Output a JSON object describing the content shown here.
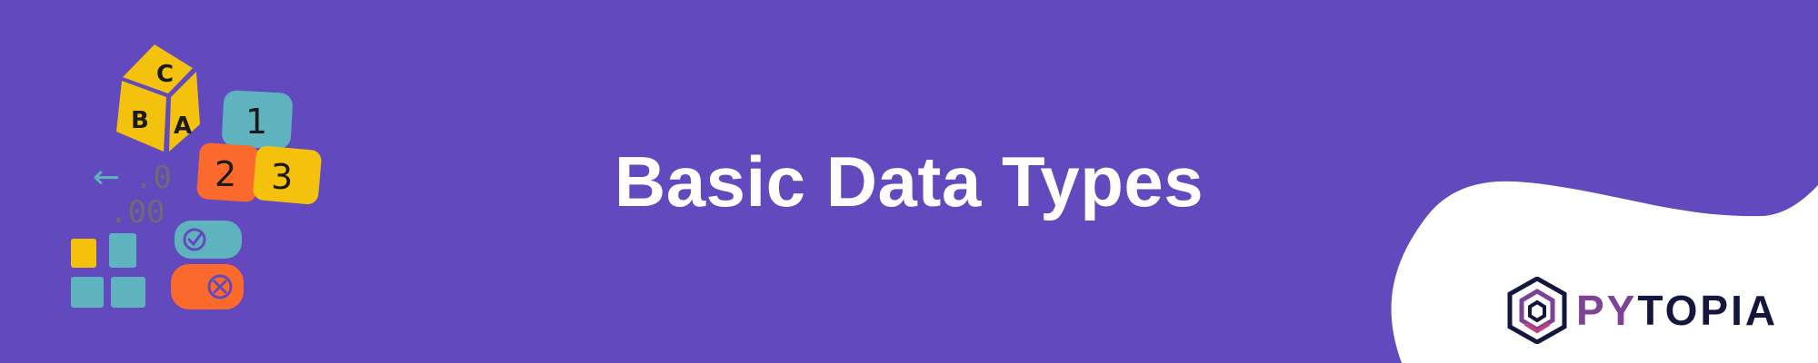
{
  "banner": {
    "title": "Basic Data Types",
    "background_color": "#6249be"
  },
  "illustration": {
    "icon": "data-types-blocks-icon",
    "letter_blocks": [
      "C",
      "B",
      "A"
    ],
    "number_blocks": [
      "1",
      "2",
      "3"
    ],
    "decimal_glyphs": {
      "arrow": "←",
      "top": ".0",
      "bottom": ".00"
    },
    "boolean_icons": [
      "check-icon",
      "cross-icon"
    ],
    "colors": {
      "yellow": "#f4c20d",
      "teal": "#5fb3bf",
      "orange": "#fb6a2c",
      "gray": "#6c6c72",
      "outline": "#1a1a1a"
    }
  },
  "brand": {
    "logo_icon": "pytopia-hexagon-icon",
    "name_part1": "PY",
    "name_part2": "TOPIA",
    "colors": {
      "purple": "#7d4296",
      "navy": "#14163d",
      "accent": "#c0407c"
    }
  }
}
